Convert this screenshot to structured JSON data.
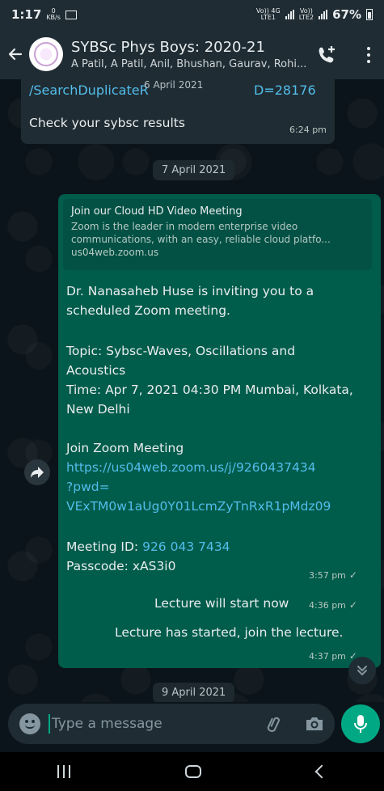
{
  "status_bar": {
    "time": "1:17",
    "net_speed": "0",
    "net_unit": "KB/s",
    "network_label": "Vo)) 4G",
    "network_sub": "LTE1",
    "network2_label": "Vo))",
    "network2_sub": "LTE2",
    "battery": "67%"
  },
  "header": {
    "title": "SYBSc Phys Boys: 2020-21",
    "subtitle": "A Patil, A Patil, Anil, Bhushan, Gaurav, Rohi..."
  },
  "messages": {
    "top_link_fragment": "/SearchDuplicateR",
    "top_link_suffix": "D=28176",
    "floating_date": "6 April 2021",
    "results_text": "Check your sybsc results",
    "results_time": "6:24 pm",
    "date_divider_1": "7 April 2021",
    "preview": {
      "title": "Join our Cloud HD Video Meeting",
      "desc": "Zoom is the leader in modern enterprise video communications, with an easy, reliable cloud platfo...",
      "domain": "us04web.zoom.us"
    },
    "zoom": {
      "line1": "Dr. Nanasaheb Huse is inviting you to a scheduled Zoom meeting.",
      "topic": "Topic: Sybsc-Waves, Oscillations and Acoustics",
      "time": "Time: Apr 7, 2021 04:30 PM Mumbai, Kolkata, New Delhi",
      "join_label": "Join Zoom Meeting",
      "url_line1": "https://us04web.zoom.us/j/9260437434",
      "url_line2": "?pwd=",
      "url_line3": "VExTM0w1aUg0Y01LcmZyTnRxR1pMdz09",
      "meeting_id_label": "Meeting ID: ",
      "meeting_id": "926 043 7434",
      "passcode": "Passcode: xAS3i0",
      "sent_time": "3:57 pm"
    },
    "lecture_start": {
      "text": "Lecture will start now",
      "time": "4:36 pm"
    },
    "lecture_started": {
      "text": "Lecture has started, join the lecture.",
      "time": "4:37 pm"
    },
    "date_divider_2": "9 April 2021"
  },
  "composer": {
    "placeholder": "Type a message"
  },
  "colors": {
    "header_bg": "#1f2c33",
    "outgoing_bubble": "#005c4b",
    "incoming_bubble": "#1f2c33",
    "accent": "#00a884",
    "link": "#53bdeb"
  },
  "icons": {
    "back": "arrow-left-icon",
    "call": "add-call-icon",
    "menu": "more-vert-icon",
    "forward": "forward-icon",
    "scroll_down": "double-chevron-down-icon",
    "emoji": "emoji-icon",
    "attach": "paperclip-icon",
    "camera": "camera-icon",
    "mic": "mic-icon"
  }
}
